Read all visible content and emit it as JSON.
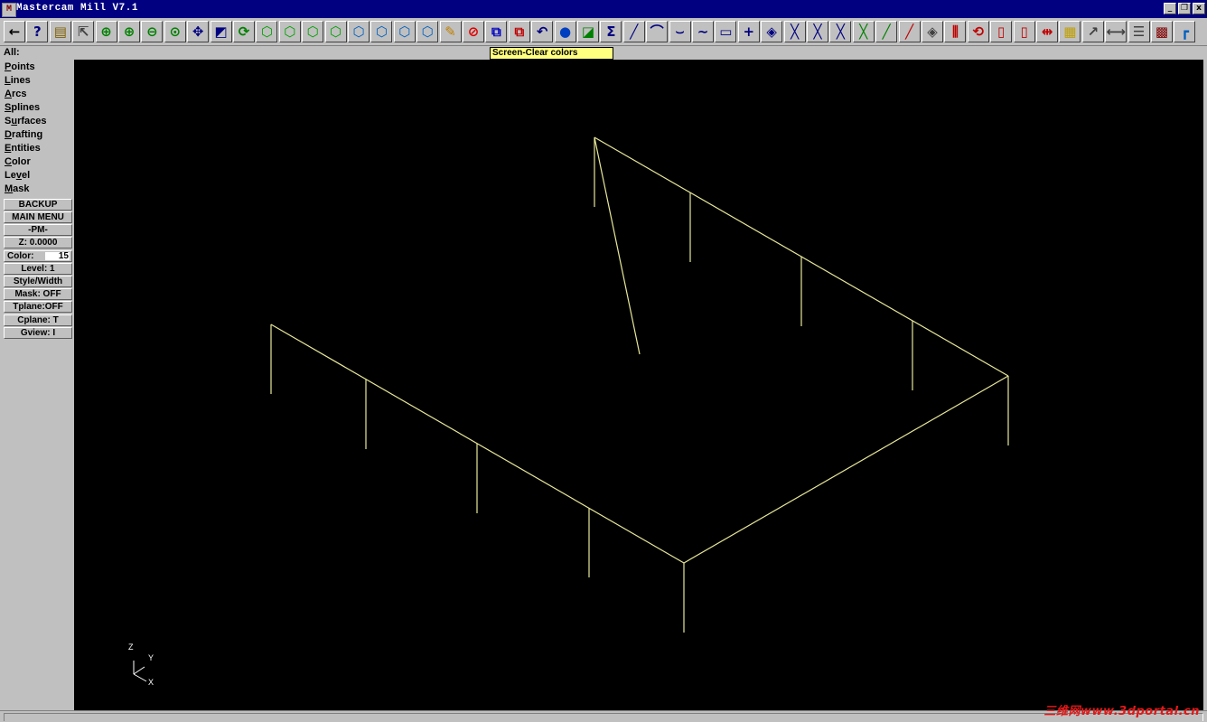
{
  "app": {
    "title": "Mastercam Mill V7.1",
    "icon_glyph": "M"
  },
  "window_buttons": [
    "_",
    "❐",
    "x"
  ],
  "toolbar": {
    "buttons": [
      {
        "name": "back-arrow-icon",
        "glyph": "←",
        "color": "#000000"
      },
      {
        "name": "help-icon",
        "glyph": "?",
        "color": "#000080"
      },
      {
        "name": "calculator-icon",
        "glyph": "▤",
        "color": "#806000"
      },
      {
        "name": "analyze-icon",
        "glyph": "⇱",
        "color": "#404040"
      },
      {
        "name": "zoom-window-icon",
        "glyph": "⊕",
        "color": "#008000"
      },
      {
        "name": "zoom-in-icon",
        "glyph": "⊕",
        "color": "#008000"
      },
      {
        "name": "zoom-out-icon",
        "glyph": "⊖",
        "color": "#008000"
      },
      {
        "name": "zoom-fit-icon",
        "glyph": "⊙",
        "color": "#008000"
      },
      {
        "name": "pan-icon",
        "glyph": "✥",
        "color": "#000080"
      },
      {
        "name": "zoom-box-icon",
        "glyph": "◩",
        "color": "#000080"
      },
      {
        "name": "rotate-view-icon",
        "glyph": "⟳",
        "color": "#008000"
      },
      {
        "name": "view-top-icon",
        "glyph": "⬡",
        "color": "#00a000"
      },
      {
        "name": "view-front-icon",
        "glyph": "⬡",
        "color": "#00a000"
      },
      {
        "name": "view-side-icon",
        "glyph": "⬡",
        "color": "#00a000"
      },
      {
        "name": "view-iso-icon",
        "glyph": "⬡",
        "color": "#00a000"
      },
      {
        "name": "cplane-top-icon",
        "glyph": "⬡",
        "color": "#0060c0"
      },
      {
        "name": "cplane-front-icon",
        "glyph": "⬡",
        "color": "#0060c0"
      },
      {
        "name": "cplane-side-icon",
        "glyph": "⬡",
        "color": "#0060c0"
      },
      {
        "name": "cplane-3d-icon",
        "glyph": "⬡",
        "color": "#0060c0"
      },
      {
        "name": "clear-colors-icon",
        "glyph": "✎",
        "color": "#c08000"
      },
      {
        "name": "clear-colors-no-icon",
        "glyph": "⊘",
        "color": "#e00000"
      },
      {
        "name": "transform-icon",
        "glyph": "⧉",
        "color": "#0000c0"
      },
      {
        "name": "copy-icon",
        "glyph": "⧉",
        "color": "#c00000"
      },
      {
        "name": "undo-icon",
        "glyph": "↶",
        "color": "#000080"
      },
      {
        "name": "shade-icon",
        "glyph": "●",
        "color": "#0040c0"
      },
      {
        "name": "layers-icon",
        "glyph": "◪",
        "color": "#008000"
      },
      {
        "name": "sum-icon",
        "glyph": "Σ",
        "color": "#000080"
      },
      {
        "name": "line-icon",
        "glyph": "╱",
        "color": "#000080"
      },
      {
        "name": "arc-icon",
        "glyph": "⌒",
        "color": "#000080"
      },
      {
        "name": "fillet-icon",
        "glyph": "⌣",
        "color": "#000080"
      },
      {
        "name": "spline-icon",
        "glyph": "∼",
        "color": "#000080"
      },
      {
        "name": "rectangle-icon",
        "glyph": "▭",
        "color": "#000080"
      },
      {
        "name": "point-icon",
        "glyph": "+",
        "color": "#000080"
      },
      {
        "name": "chamfer-icon",
        "glyph": "◈",
        "color": "#000080"
      },
      {
        "name": "trim-icon",
        "glyph": "╳",
        "color": "#000080"
      },
      {
        "name": "trim-two-icon",
        "glyph": "╳",
        "color": "#000080"
      },
      {
        "name": "trim-three-icon",
        "glyph": "╳",
        "color": "#000080"
      },
      {
        "name": "divide-icon",
        "glyph": "╳",
        "color": "#008000"
      },
      {
        "name": "extend-icon",
        "glyph": "╱",
        "color": "#008000"
      },
      {
        "name": "break-icon",
        "glyph": "╱",
        "color": "#c00000"
      },
      {
        "name": "mirror-icon",
        "glyph": "◈",
        "color": "#404040"
      },
      {
        "name": "offset-icon",
        "glyph": "⫼",
        "color": "#c00000"
      },
      {
        "name": "rotate-icon",
        "glyph": "⟲",
        "color": "#c00000"
      },
      {
        "name": "scale-icon",
        "glyph": "▯",
        "color": "#c00000"
      },
      {
        "name": "translate-icon",
        "glyph": "▯",
        "color": "#c00000"
      },
      {
        "name": "stretch-icon",
        "glyph": "⇹",
        "color": "#c00000"
      },
      {
        "name": "grid-icon",
        "glyph": "▦",
        "color": "#c0a000"
      },
      {
        "name": "xyz-icon",
        "glyph": "↗",
        "color": "#404040"
      },
      {
        "name": "dimension-icon",
        "glyph": "⟷",
        "color": "#404040"
      },
      {
        "name": "toolpath-icon",
        "glyph": "☰",
        "color": "#404040"
      },
      {
        "name": "backplot-icon",
        "glyph": "▩",
        "color": "#800000"
      },
      {
        "name": "corner-icon",
        "glyph": "┏",
        "color": "#0060c0"
      }
    ]
  },
  "prompt": "All:",
  "tooltip": "Screen-Clear colors",
  "main_menu": {
    "items": [
      {
        "hotkey": "P",
        "rest": "oints"
      },
      {
        "hotkey": "L",
        "rest": "ines"
      },
      {
        "hotkey": "A",
        "rest": "rcs"
      },
      {
        "hotkey": "S",
        "rest": "plines"
      },
      {
        "hotkey": "u",
        "pre": "S",
        "rest": "rfaces"
      },
      {
        "hotkey": "D",
        "rest": "rafting"
      },
      {
        "hotkey": "E",
        "rest": "ntities"
      },
      {
        "hotkey": "C",
        "rest": "olor"
      },
      {
        "hotkey": "v",
        "pre": "Le",
        "rest": "el"
      },
      {
        "hotkey": "M",
        "rest": "ask"
      }
    ]
  },
  "secondary_menu": {
    "backup": "BACKUP",
    "main_menu": "MAIN MENU",
    "pm": "-PM-",
    "z": "Z:  0.0000",
    "color_label": "Color:",
    "color_value": "15",
    "level": "Level:  1",
    "style": "Style/Width",
    "mask": "Mask:  OFF",
    "tplane": "Tplane:OFF",
    "cplane": "Cplane:  T",
    "gview": "Gview:   I"
  },
  "axis_triad": {
    "z": "Z",
    "y": "Y",
    "x": "X"
  },
  "geometry_color": "#e8e89a",
  "watermark": "三维网www.3dportal.cn"
}
